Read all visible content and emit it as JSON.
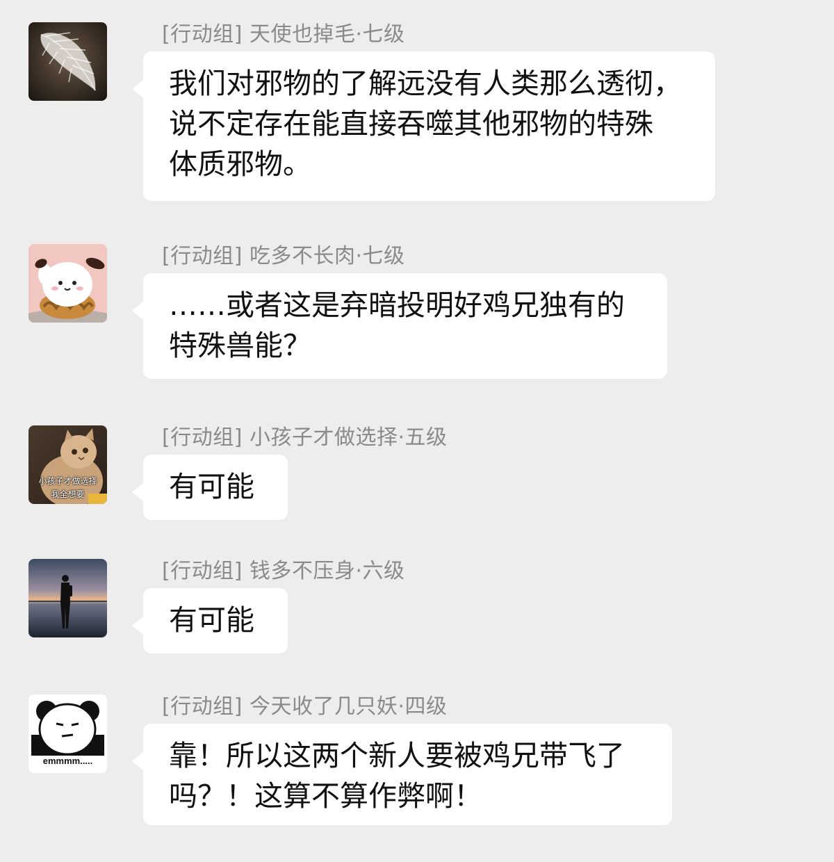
{
  "messages": [
    {
      "sender": "[行动组] 天使也掉毛·七级",
      "avatar_icon": "white-feather-icon",
      "text": "我们对邪物的了解远没有人类那么透彻，\n说不定存在能直接吞噬其他邪物的特殊\n体质邪物。"
    },
    {
      "sender": "[行动组] 吃多不长肉·七级",
      "avatar_icon": "white-puppy-toy-icon",
      "text": "……或者这是弃暗投明好鸡兄独有的\n特殊兽能？"
    },
    {
      "sender": "[行动组] 小孩子才做选择·五级",
      "avatar_icon": "cat-meme-icon",
      "avatar_caption": [
        "小孩子才做选择",
        "我全想要"
      ],
      "text": "有可能"
    },
    {
      "sender": "[行动组] 钱多不压身·六级",
      "avatar_icon": "silhouette-lake-sunset-icon",
      "text": "有可能"
    },
    {
      "sender": "[行动组] 今天收了几只妖·四级",
      "avatar_icon": "panda-meme-icon",
      "avatar_caption": "emmmm.....",
      "text": "靠！所以这两个新人要被鸡兄带飞了\n吗？！这算不算作弊啊！"
    }
  ],
  "colors": {
    "background": "#ededed",
    "bubble": "#ffffff",
    "sender_text": "#8a8a8a",
    "message_text": "#111111"
  }
}
